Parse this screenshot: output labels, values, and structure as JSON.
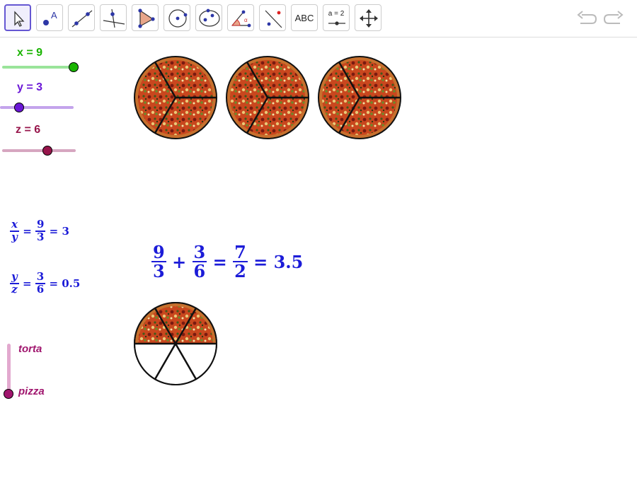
{
  "toolbar": {
    "tools": [
      {
        "name": "move-tool",
        "icon": "arrow-cursor-icon"
      },
      {
        "name": "point-tool",
        "icon": "point-icon"
      },
      {
        "name": "line-tool",
        "icon": "line-icon"
      },
      {
        "name": "perpendicular-tool",
        "icon": "perpendicular-line-icon"
      },
      {
        "name": "polygon-tool",
        "icon": "polygon-icon"
      },
      {
        "name": "circle-tool",
        "icon": "circle-icon"
      },
      {
        "name": "conic-tool",
        "icon": "ellipse-icon"
      },
      {
        "name": "angle-tool",
        "icon": "angle-icon"
      },
      {
        "name": "reflect-tool",
        "icon": "reflect-icon"
      },
      {
        "name": "text-tool",
        "label": "ABC"
      },
      {
        "name": "slider-tool",
        "label": "a = 2"
      },
      {
        "name": "move-graphics-tool",
        "icon": "move-arrows-icon"
      }
    ],
    "undo_icon": "undo-icon",
    "redo_icon": "redo-icon"
  },
  "sliders": {
    "x": {
      "label": "x = 9",
      "value": 9,
      "fraction": 1.0,
      "color": "#19b400",
      "track": "#9ae49a"
    },
    "y": {
      "label": "y = 3",
      "value": 3,
      "fraction": 0.0,
      "color": "#6a16d6",
      "track": "#c4a4ec"
    },
    "z": {
      "label": "z = 6",
      "value": 6,
      "fraction": 0.6,
      "color": "#97154b",
      "track": "#d6a6c0"
    }
  },
  "formulas": {
    "xy": {
      "lhs_num": "x",
      "lhs_den": "y",
      "rhs_num": "9",
      "rhs_den": "3",
      "result": "3"
    },
    "yz": {
      "lhs_num": "y",
      "lhs_den": "z",
      "rhs_num": "3",
      "rhs_den": "6",
      "result": "0.5"
    },
    "sum": {
      "a_num": "9",
      "a_den": "3",
      "b_num": "3",
      "b_den": "6",
      "c_num": "7",
      "c_den": "2",
      "result": "3.5"
    }
  },
  "toggle": {
    "option_top": "torta",
    "option_bottom": "pizza",
    "selected": "pizza",
    "color": "#a0166e",
    "track": "#e2a9cf"
  },
  "pizzas": {
    "top_count": 3,
    "slices_per_pizza": 3,
    "bottom_slices": 6,
    "bottom_filled": 3
  },
  "colors": {
    "formula": "#1c1cd8",
    "crust": "#c7702d",
    "sauce": "#b53217"
  }
}
